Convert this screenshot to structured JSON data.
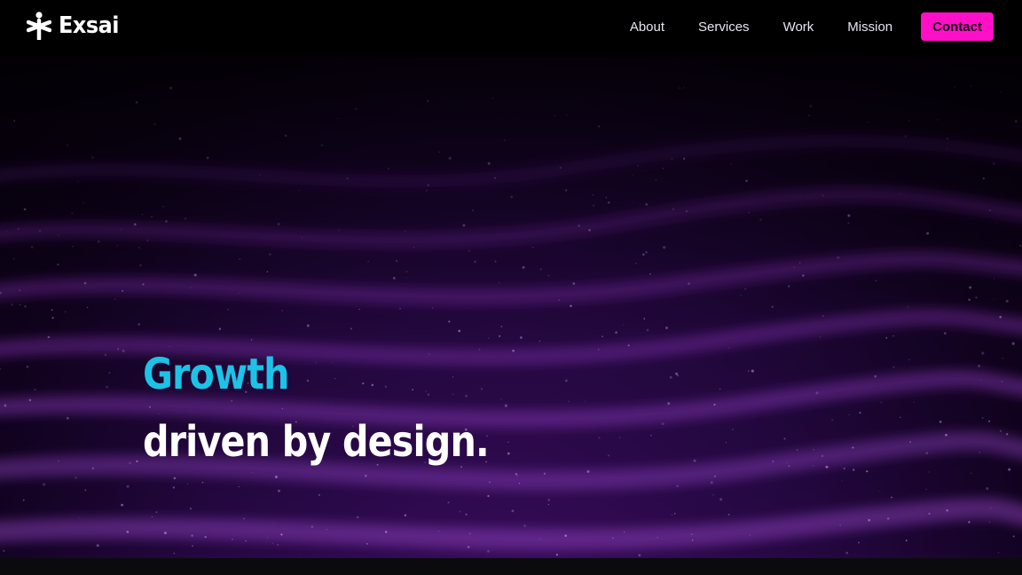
{
  "brand": {
    "name": "Exsai",
    "icon": "asterisk-figure-icon"
  },
  "nav": {
    "links": [
      "About",
      "Services",
      "Work",
      "Mission"
    ],
    "contact_label": "Contact"
  },
  "hero": {
    "headline_accent": "Growth",
    "headline_main": "driven by design.",
    "background_icon": "particle-waves-background"
  },
  "colors": {
    "accent_cyan": "#1cc3e6",
    "contact_button": "#ff10c8",
    "background": "#1a0630"
  }
}
